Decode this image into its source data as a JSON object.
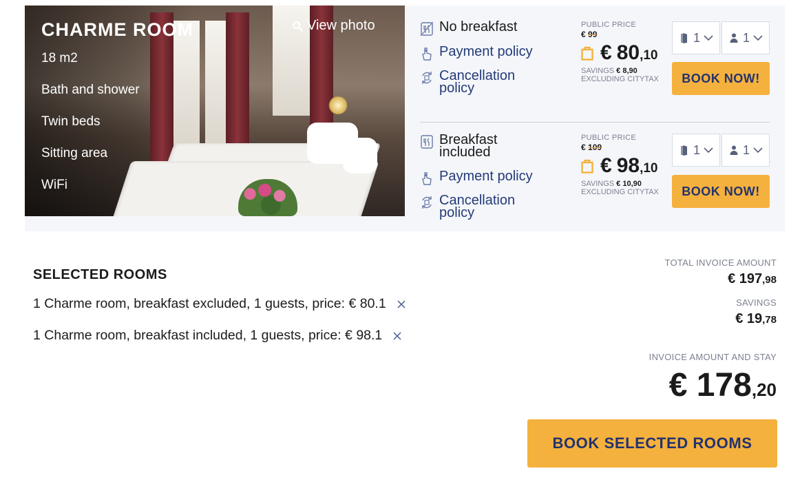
{
  "room": {
    "title": "CHARME ROOM",
    "view_photo_label": "View photo",
    "features": [
      "18 m2",
      "Bath and shower",
      "Twin beds",
      "Sitting area",
      "WiFi"
    ]
  },
  "rates": [
    {
      "meal": "No breakfast",
      "payment_policy": "Payment policy",
      "cancellation_policy_line1": "Cancellation",
      "cancellation_policy_line2": "policy",
      "public_price_label": "PUBLIC PRICE",
      "old_price_currency": "€",
      "old_price_value": "99",
      "price_currency": "€",
      "price_int": "80",
      "price_dec": ",10",
      "savings_label": "SAVINGS",
      "savings_value": "€ 8,90",
      "excluding_label": "EXCLUDING CITYTAX",
      "rooms_selected": "1",
      "guests_selected": "1",
      "book_label": "BOOK NOW!"
    },
    {
      "meal_line1": "Breakfast",
      "meal_line2": "included",
      "payment_policy": "Payment policy",
      "cancellation_policy_line1": "Cancellation",
      "cancellation_policy_line2": "policy",
      "public_price_label": "PUBLIC PRICE",
      "old_price_currency": "€",
      "old_price_value": "109",
      "price_currency": "€",
      "price_int": "98",
      "price_dec": ",10",
      "savings_label": "SAVINGS",
      "savings_value": "€ 10,90",
      "excluding_label": "EXCLUDING CITYTAX",
      "rooms_selected": "1",
      "guests_selected": "1",
      "book_label": "BOOK NOW!"
    }
  ],
  "selection": {
    "title": "SELECTED ROOMS",
    "items": [
      "1 Charme room, breakfast excluded, 1 guests, price: € 80.1",
      "1 Charme room, breakfast included, 1 guests, price: € 98.1"
    ],
    "total_label": "TOTAL INVOICE AMOUNT",
    "total_int": "€ 197",
    "total_dec": ",98",
    "savings_label": "SAVINGS",
    "savings_int": "€ 19",
    "savings_dec": ",78",
    "invoice_label": "INVOICE AMOUNT AND STAY",
    "invoice_int": "€ 178",
    "invoice_dec": ",20",
    "book_selected_label": "BOOK SELECTED ROOMS"
  },
  "icons": {
    "search": "search-icon",
    "meal": "meal-icon",
    "payment": "payment-icon",
    "cancellation": "cancellation-icon",
    "price_bag": "shopping-bag-icon",
    "room": "door-icon",
    "guest": "person-icon",
    "chevron": "chevron-down-icon",
    "remove": "close-icon"
  },
  "colors": {
    "accent": "#f5b13d",
    "link": "#243a78",
    "card_bg": "#f4f6fa",
    "muted": "#7c8190"
  }
}
